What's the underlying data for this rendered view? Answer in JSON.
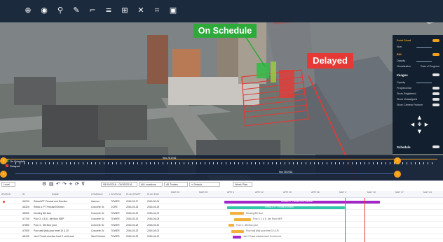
{
  "overlay": {
    "on_schedule": "On Schedule",
    "delayed": "Delayed"
  },
  "toolbar": {
    "icons": [
      "target-icon",
      "camera-icon",
      "pin-icon",
      "note-icon",
      "measure-icon",
      "layers-icon",
      "grid-icon",
      "fullscreen-icon",
      "crop-icon",
      "image-icon"
    ]
  },
  "panel": {
    "point_cloud": "Point Cloud",
    "size": "Size",
    "bim": "BIM",
    "opacity": "Opacity",
    "visualization": "Visualization",
    "visualization_value": "Date of Progress",
    "images": "Images",
    "img_opacity": "Opacity",
    "progress_bar": "Progress Bar",
    "show_registered": "Show Registered",
    "show_unassigned": "Show Unassigned",
    "show_camera_frustum": "Show Camera Frustum",
    "schedule": "Schedule"
  },
  "timeline": {
    "legend_on_schedule": "On Schedule",
    "legend_delayed": "Delayed",
    "marker": "Nov 28 2016",
    "marker2": "Nov 28 2016"
  },
  "gantt_toolbar": {
    "level": "Level",
    "date_range": "05/19/2016 - 09/30/2016",
    "locations": "All Locations",
    "trades": "All Trades",
    "search": "Search...",
    "view": "Week Plan"
  },
  "columns": {
    "status": "STATUS",
    "id": "ID",
    "name": "NAME",
    "company": "COMPANY",
    "location": "LOCATION",
    "plan_start": "PLAN START",
    "plan_end": "PLAN END"
  },
  "weeks": [
    "MAR 22",
    "MAR 29",
    "APR 5",
    "APR 12",
    "APR 19",
    "APR 26",
    "MAY 3",
    "MAY 10",
    "MAY 17",
    "MAY 24"
  ],
  "rows": [
    {
      "id": "A6200",
      "name": "Rebar&PT Precast and Erection",
      "company": "Harmon",
      "location": "TOWER",
      "start": "2016-03-27",
      "end": "2016-05-04",
      "bar_label": "Rebar&PT Precast and Erection"
    },
    {
      "id": "A6320",
      "name": "Rebar & PT Precast Erection",
      "company": "Concrete Gr.",
      "location": "CORE",
      "start": "2016-03-28",
      "end": "2016-04-25",
      "bar_label": "Rebar & PT Precast Erection"
    },
    {
      "id": "A6550",
      "name": "Decking 8th floor",
      "company": "Concrete Gr.",
      "location": "TOWER",
      "start": "2016-03-29",
      "end": "2016-04-01",
      "bar_label": "Decking 8th floor"
    },
    {
      "id": "A7700",
      "name": "Pour 3, 4 & 5 - 8th floor MEP",
      "company": "Concrete Gr.",
      "location": "TOWER",
      "start": "2016-03-31",
      "end": "2016-04-04",
      "bar_label": "Pour 3, 4 & 5 - 8th Floor MEP"
    },
    {
      "id": "A7850",
      "name": "Pour 4 - 8th floor pour",
      "company": "Concrete Gr.",
      "location": "TOWER",
      "start": "2016-03-28",
      "end": "2016-03-30",
      "bar_label": "Pour 4 - 8th floor pour"
    },
    {
      "id": "A7900",
      "name": "Pour wall (thk) pour level 10 & 20",
      "company": "Concrete Gr.",
      "location": "TOWER",
      "start": "2016-03-29",
      "end": "2016-04-01",
      "bar_label": "Pour wall (thk) pour level 10 & 20"
    },
    {
      "id": "A8100",
      "name": "Jan 27 back erection level 9 north end",
      "company": "Steel Service",
      "location": "TOWER",
      "start": "2016-03-30",
      "end": "2016-04-02",
      "bar_label": "Jan 27 back erection level 9 north end"
    }
  ],
  "colors": {
    "toolbar_bg": "#1b2a3c",
    "accent": "#f6a21a",
    "on_schedule": "#2eaa3a",
    "delayed": "#e53935",
    "bar_purple": "#a326c9",
    "bar_teal": "#2fc7a8",
    "bar_orange": "#f2b13a"
  }
}
